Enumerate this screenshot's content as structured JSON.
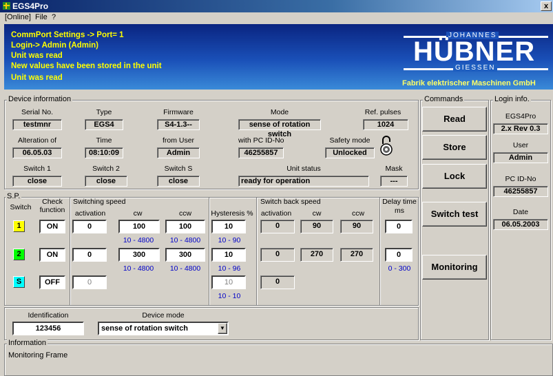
{
  "window": {
    "title": "EGS4Pro",
    "close_label": "x"
  },
  "menu": [
    "[Online]",
    "File",
    "?"
  ],
  "status_lines": [
    "CommPort Settings -> Port= 1",
    "Login-> Admin  (Admin)",
    "Unit was read",
    "New values have been stored in the unit",
    "Unit was read"
  ],
  "logo": {
    "top": "JOHANNES",
    "main": "HÜBNER",
    "bottom": "GIESSEN",
    "caption": "Fabrik elektrischer Maschinen GmbH"
  },
  "device_info": {
    "title": "Device information",
    "serial_label": "Serial No.",
    "serial": "testmnr",
    "type_label": "Type",
    "type": "EGS4",
    "firmware_label": "Firmware",
    "firmware": "S4-1.3--",
    "mode_label": "Mode",
    "mode": "sense of rotation switch",
    "refpulses_label": "Ref. pulses",
    "refpulses": "1024",
    "alteration_label": "Alteration of",
    "alteration": "06.05.03",
    "time_label": "Time",
    "time": "08:10:09",
    "fromuser_label": "from User",
    "fromuser": "Admin",
    "pcid_label": "with PC ID-No",
    "pcid": "46255857",
    "safety_label": "Safety mode",
    "safety": "Unlocked",
    "switch1_label": "Switch 1",
    "switch1": "close",
    "switch2_label": "Switch 2",
    "switch2": "close",
    "switchS_label": "Switch S",
    "switchS": "close",
    "unitstatus_label": "Unit status",
    "unitstatus": "ready for operation",
    "mask_label": "Mask",
    "mask": "---"
  },
  "sp": {
    "title": "S.P.",
    "switch_label": "Switch",
    "check_label_1": "Check",
    "check_label_2": "function",
    "speed_title": "Switching speed",
    "activation_label": "activation",
    "cw_label": "cw",
    "ccw_label": "ccw",
    "hyst_label": "Hysteresis %",
    "back_title": "Switch back speed",
    "back_activation_label": "activation",
    "back_cw_label": "cw",
    "back_ccw_label": "ccw",
    "delay_label_1": "Delay time",
    "delay_label_2": "ms",
    "rows": [
      {
        "id": "1",
        "color": "#ffff00",
        "check": "ON",
        "activation": "0",
        "cw": "100",
        "ccw": "100",
        "hyst": "10",
        "back_act": "0",
        "back_cw": "90",
        "back_ccw": "90",
        "delay": "0",
        "cw_range": "10 - 4800",
        "ccw_range": "10 - 4800",
        "hyst_range": "10 - 90",
        "delay_range": ""
      },
      {
        "id": "2",
        "color": "#00ff00",
        "check": "ON",
        "activation": "0",
        "cw": "300",
        "ccw": "300",
        "hyst": "10",
        "back_act": "0",
        "back_cw": "270",
        "back_ccw": "270",
        "delay": "0",
        "cw_range": "10 - 4800",
        "ccw_range": "10 - 4800",
        "hyst_range": "10 - 96",
        "delay_range": "0 - 300"
      },
      {
        "id": "S",
        "color": "#00ffff",
        "check": "OFF",
        "activation": "0",
        "hyst": "10",
        "back_act": "0",
        "hyst_range": "10 - 10"
      }
    ]
  },
  "identification": {
    "label": "Identification",
    "value": "123456"
  },
  "device_mode": {
    "label": "Device mode",
    "value": "sense of rotation switch"
  },
  "information": {
    "title": "Information",
    "text": "Monitoring Frame"
  },
  "commands": {
    "title": "Commands",
    "read": "Read",
    "store": "Store",
    "lock": "Lock",
    "switch_test": "Switch test",
    "monitoring": "Monitoring"
  },
  "login_info": {
    "title": "Login info.",
    "app_label": "EGS4Pro",
    "version": "2.x Rev 0.3",
    "user_label": "User",
    "user": "Admin",
    "pcid_label": "PC ID-No",
    "pcid": "46255857",
    "date_label": "Date",
    "date": "06.05.2003"
  }
}
